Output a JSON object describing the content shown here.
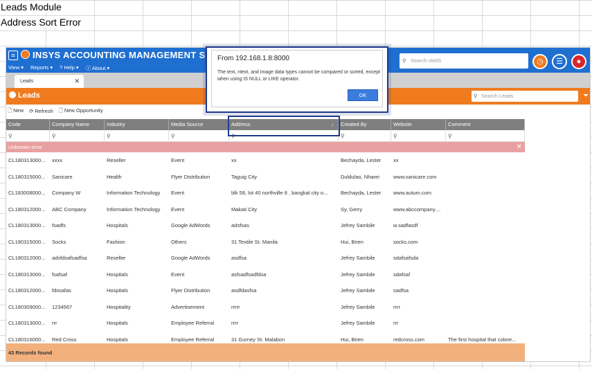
{
  "sheet": {
    "line1": "Leads Module",
    "line2": "Address Sort Error"
  },
  "app": {
    "brand": "INSYS ACCOUNTING MANAGEMENT SYSTE",
    "menus": [
      "View ▾",
      "Reports ▾",
      "? Help ▾",
      "ⓘ About ▾"
    ],
    "search_placeholder": "Search IAMS",
    "tab_label": "Leads",
    "module_title": "Leads",
    "module_search_placeholder": "Search Leads",
    "toolbar": {
      "new": "New",
      "refresh": "Refresh",
      "new_opportunity": "New Opportunity"
    }
  },
  "dialog": {
    "from": "From 192.168.1.8:8000",
    "message": "The text, ntext, and image data types cannot be compared or sorted, except when using IS NULL or LIKE operator.",
    "ok": "OK"
  },
  "table": {
    "headers": [
      "Code",
      "Company Name",
      "Industry",
      "Media Source",
      "Address",
      "Created By",
      "Website",
      "Comment"
    ],
    "sort_indicator": "↓",
    "error": "Unknown error",
    "rows": [
      [
        "CL180313000...",
        "xxxx",
        "Reseller",
        "Event",
        "xx",
        "Bechayda, Lester",
        "xx",
        ""
      ],
      [
        "CL180315000...",
        "Sanicare",
        "Health",
        "Flyer Distribution",
        "Taguig City",
        "Duldulao, Nharei",
        "www.sanicare.com",
        ""
      ],
      [
        "CL183008000...",
        "Company W",
        "Information Technology",
        "Event",
        "blk 58, lot 40 northville 8 , bangkal city o...",
        "Bechayda, Lester",
        "www.autum.com",
        ""
      ],
      [
        "CL180312000...",
        "ABC Company",
        "Information Technology",
        "Event",
        "Makati City",
        "Sy, Gerry",
        "www.abccompany....",
        ""
      ],
      [
        "CL180313000...",
        "fsadfs",
        "Hospitals",
        "Google AdWords",
        "adsfsas",
        "Jefrey Sambile",
        "w.sadfasdf",
        ""
      ],
      [
        "CL180315000...",
        "Socks",
        "Fashion",
        "Others",
        "31 Textile St. Manila",
        "Hui, Brien",
        "socks.com",
        ""
      ],
      [
        "CL180312000...",
        "adsfdsafsadfsa",
        "Reseller",
        "Google AdWords",
        "asdfsa",
        "Jefrey Sambile",
        "sdafsafsda",
        ""
      ],
      [
        "CL180313000...",
        "fsafsaf",
        "Hospitals",
        "Event",
        "asfsadfsadfdsa",
        "Jefrey Sambile",
        "sdafsaf",
        ""
      ],
      [
        "CL180312000...",
        "fdssafas",
        "Hospitals",
        "Flyer Distribution",
        "asdfdasfsa",
        "Jefrey Sambile",
        "sadfsa",
        ""
      ],
      [
        "CL180309000...",
        "1234567",
        "Hospitality",
        "Advertisement",
        "rrrrr",
        "Jefrey Sambile",
        "rrrr",
        ""
      ],
      [
        "CL180313000...",
        "rrr",
        "Hospitals",
        "Employee Referral",
        "rrrr",
        "Jefrey Sambile",
        "rrr",
        ""
      ],
      [
        "CL180316000...",
        "Red Cross",
        "Hospitals",
        "Employee Referral",
        "31 Gurney St. Malabon",
        "Hui, Brien",
        "redcross.com",
        "The first hospital that colore..."
      ]
    ],
    "footer": "43 Records found"
  }
}
